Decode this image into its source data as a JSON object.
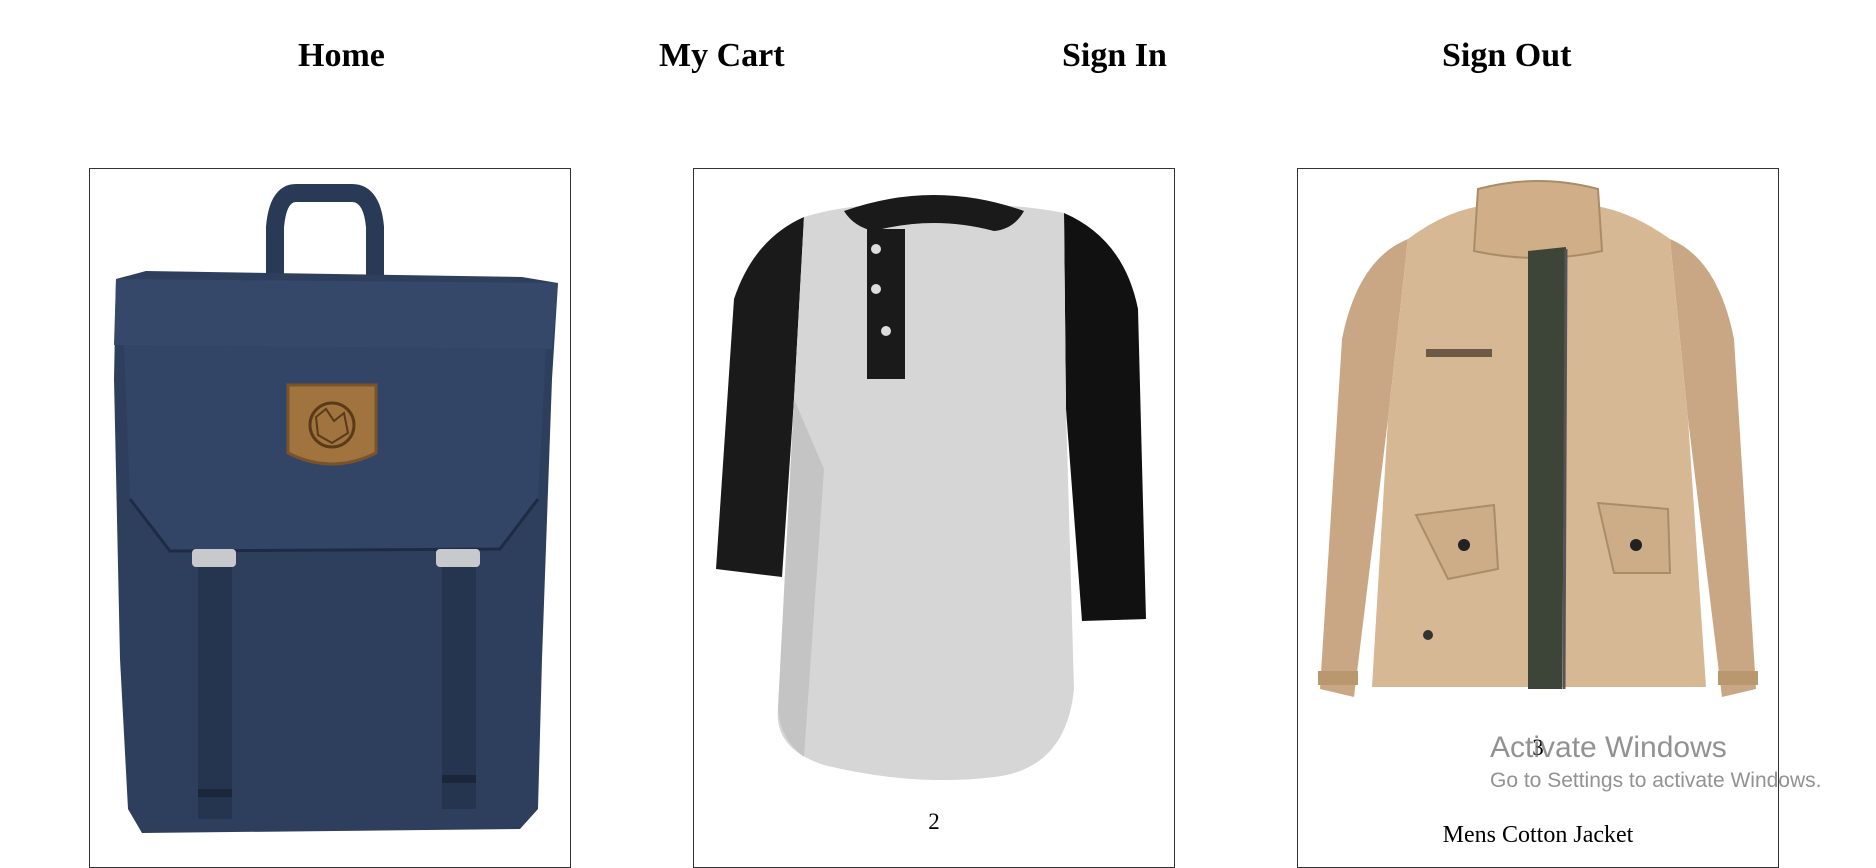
{
  "nav": {
    "home": "Home",
    "my_cart": "My Cart",
    "sign_in": "Sign In",
    "sign_out": "Sign Out"
  },
  "products": [
    {
      "id": "",
      "name": "",
      "image": "navy-backpack-image"
    },
    {
      "id": "2",
      "name": "",
      "image": "raglan-henley-shirt-image"
    },
    {
      "id": "3",
      "name": "Mens Cotton Jacket",
      "image": "khaki-jacket-image"
    }
  ],
  "watermark": {
    "title": "Activate Windows",
    "subtitle": "Go to Settings to activate Windows."
  }
}
